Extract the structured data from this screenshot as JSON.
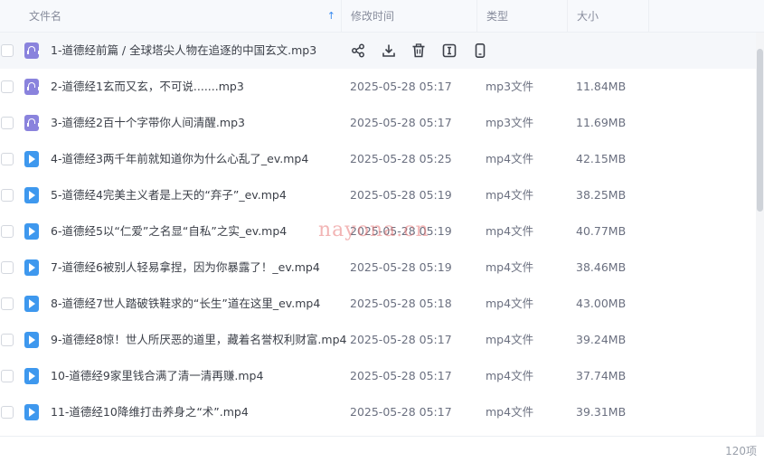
{
  "header": {
    "col_name": "文件名",
    "col_time": "修改时间",
    "col_type": "类型",
    "col_size": "大小",
    "sort_icon": "↑"
  },
  "files": [
    {
      "icon": "audio",
      "name": "1-道德经前篇 / 全球塔尖人物在追逐的中国玄文.mp3",
      "time": "",
      "type": "",
      "size": ""
    },
    {
      "icon": "audio",
      "name": "2-道德经1玄而又玄，不可说.......mp3",
      "time": "2025-05-28 05:17",
      "type": "mp3文件",
      "size": "11.84MB"
    },
    {
      "icon": "audio",
      "name": "3-道德经2百十个字带你人间清醒.mp3",
      "time": "2025-05-28 05:17",
      "type": "mp3文件",
      "size": "11.69MB"
    },
    {
      "icon": "video",
      "name": "4-道德经3两千年前就知道你为什么心乱了_ev.mp4",
      "time": "2025-05-28 05:25",
      "type": "mp4文件",
      "size": "42.15MB"
    },
    {
      "icon": "video",
      "name": "5-道德经4完美主义者是上天的“弃子”_ev.mp4",
      "time": "2025-05-28 05:19",
      "type": "mp4文件",
      "size": "38.25MB"
    },
    {
      "icon": "video",
      "name": "6-道德经5以“仁爱”之名显“自私”之实_ev.mp4",
      "time": "2025-05-28 05:19",
      "type": "mp4文件",
      "size": "40.77MB"
    },
    {
      "icon": "video",
      "name": "7-道德经6被别人轻易拿捏，因为你暴露了！_ev.mp4",
      "time": "2025-05-28 05:19",
      "type": "mp4文件",
      "size": "38.46MB"
    },
    {
      "icon": "video",
      "name": "8-道德经7世人踏破铁鞋求的“长生”道在这里_ev.mp4",
      "time": "2025-05-28 05:18",
      "type": "mp4文件",
      "size": "43.00MB"
    },
    {
      "icon": "video",
      "name": "9-道德经8惊！世人所厌恶的道里，藏着名誉权利财富.mp4",
      "time": "2025-05-28 05:17",
      "type": "mp4文件",
      "size": "39.24MB"
    },
    {
      "icon": "video",
      "name": "10-道德经9家里钱合满了清一清再赚.mp4",
      "time": "2025-05-28 05:17",
      "type": "mp4文件",
      "size": "37.74MB"
    },
    {
      "icon": "video",
      "name": "11-道德经10降维打击养身之“术”.mp4",
      "time": "2025-05-28 05:17",
      "type": "mp4文件",
      "size": "39.31MB"
    }
  ],
  "hover_actions": [
    "share-icon",
    "download-icon",
    "delete-icon",
    "rename-icon",
    "phone-icon"
  ],
  "watermark": "nayona.cn",
  "footer": {
    "count": "120项"
  },
  "colors": {
    "audio_icon": "#8a83dd",
    "video_icon": "#3e98ee",
    "sort_accent": "#3a8bf0"
  }
}
